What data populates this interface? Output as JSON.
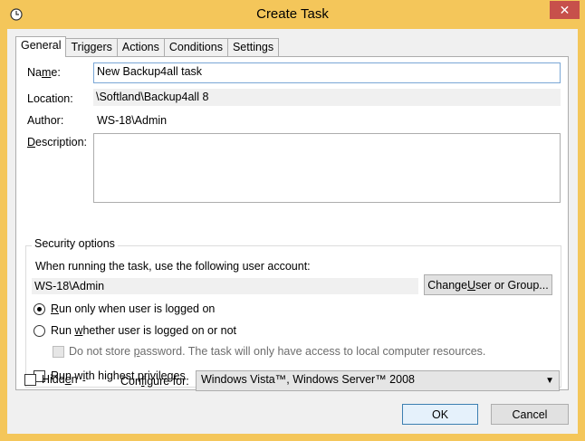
{
  "window": {
    "title": "Create Task",
    "close_label": "✕"
  },
  "tabs": [
    {
      "label": "General"
    },
    {
      "label": "Triggers"
    },
    {
      "label": "Actions"
    },
    {
      "label": "Conditions"
    },
    {
      "label": "Settings"
    }
  ],
  "general": {
    "name_label_a": "Na",
    "name_label_u": "m",
    "name_label_b": "e:",
    "name_value": "New Backup4all task",
    "location_label": "Location:",
    "location_value": "\\Softland\\Backup4all 8",
    "author_label": "Author:",
    "author_value": "WS-18\\Admin",
    "description_label_u": "D",
    "description_label_b": "escription:",
    "description_value": ""
  },
  "security": {
    "title": "Security options",
    "account_prompt": "When running the task, use the following user account:",
    "account_value": "WS-18\\Admin",
    "change_button_a": "Change ",
    "change_button_u": "U",
    "change_button_b": "ser or Group...",
    "radio_logged_on_a": "",
    "radio_logged_on_u": "R",
    "radio_logged_on_b": "un only when user is logged on",
    "radio_whether_a": "Run ",
    "radio_whether_u": "w",
    "radio_whether_b": "hether user is logged on or not",
    "no_store_a": "Do not store ",
    "no_store_u": "p",
    "no_store_b": "assword.  The task will only have access to local computer resources.",
    "highest_a": "Run w",
    "highest_u": "i",
    "highest_b": "th highest privileges"
  },
  "bottom": {
    "hidden_a": "Hidd",
    "hidden_u": "e",
    "hidden_b": "n",
    "configure_a": "Con",
    "configure_u": "f",
    "configure_b": "igure for:",
    "configure_value": "Windows Vista™, Windows Server™ 2008",
    "ok_label": "OK",
    "cancel_label": "Cancel"
  }
}
